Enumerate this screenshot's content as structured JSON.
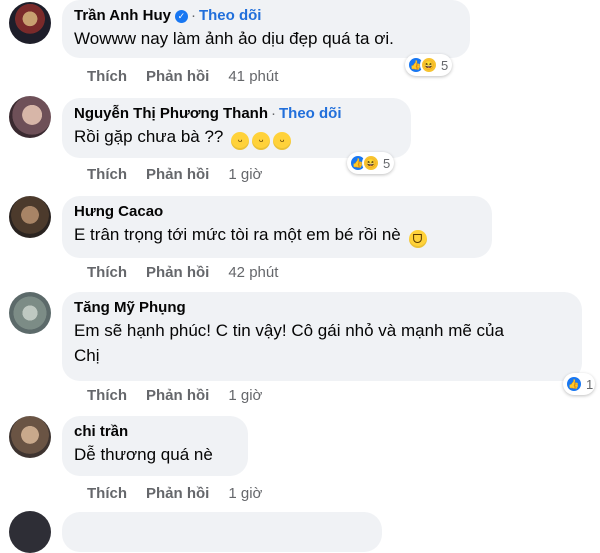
{
  "actions": {
    "like": "Thích",
    "reply": "Phản hồi"
  },
  "comments": [
    {
      "name": "Trần Anh Huy",
      "follow": "Theo dõi",
      "text": "Wowww nay làm ảnh ảo dịu đẹp quá ta ơi.",
      "reaction_count": "5",
      "time": "41 phút"
    },
    {
      "name": "Nguyễn Thị Phương Thanh",
      "follow": "Theo dõi",
      "text": "Rồi gặp chưa bà ??",
      "reaction_count": "5",
      "time": "1 giờ"
    },
    {
      "name": "Hưng Cacao",
      "text": "E trân trọng tới mức tòi ra một em bé rồi nè",
      "time": "42 phút"
    },
    {
      "name": "Tăng Mỹ Phụng",
      "text_line1": "Em sẽ hạnh phúc! C tin vậy! Cô gái nhỏ và mạnh mẽ của",
      "text_line2": "Chị",
      "reaction_count": "1",
      "time": "1 giờ"
    },
    {
      "name": "chi trần",
      "text": "Dễ thương quá nè",
      "time": "1 giờ"
    }
  ],
  "icons": {
    "verified": "verified-badge-icon",
    "like": "like-reaction-icon",
    "haha": "haha-reaction-icon",
    "emoji_grin": "grinning-face-emoji",
    "emoji_laugh": "laughing-face-emoji"
  },
  "colors": {
    "bubble": "#f0f2f5",
    "link": "#216fdb",
    "like": "#1877f2",
    "meta": "#65676b"
  }
}
